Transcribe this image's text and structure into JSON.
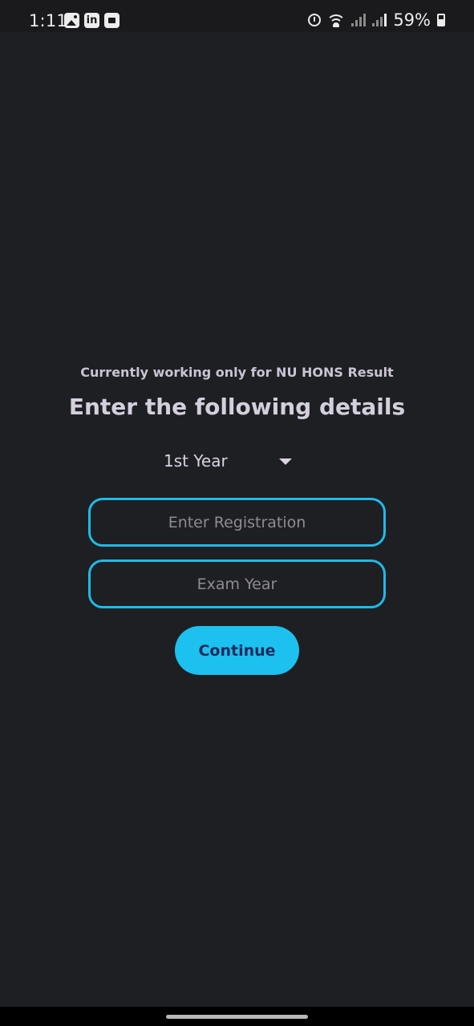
{
  "status_bar": {
    "time": "1:11",
    "battery_percent": "59%",
    "left_icons": [
      "gallery-icon",
      "linkedin-icon",
      "store-icon"
    ],
    "linkedin_glyph": "in",
    "right_icons": [
      "alarm-icon",
      "wifi-icon",
      "signal-icon",
      "signal-icon",
      "battery-icon"
    ]
  },
  "main": {
    "subtitle": "Currently working only for NU HONS Result",
    "title": "Enter the following details",
    "year_dropdown": {
      "selected": "1st Year"
    },
    "registration_field": {
      "value": "",
      "placeholder": "Enter Registration"
    },
    "exam_year_field": {
      "value": "",
      "placeholder": "Exam Year"
    },
    "continue_label": "Continue"
  },
  "colors": {
    "background": "#1e1f23",
    "accent": "#1cc1ef",
    "button_text": "#1c2a5c",
    "text": "#d4cfdd"
  }
}
